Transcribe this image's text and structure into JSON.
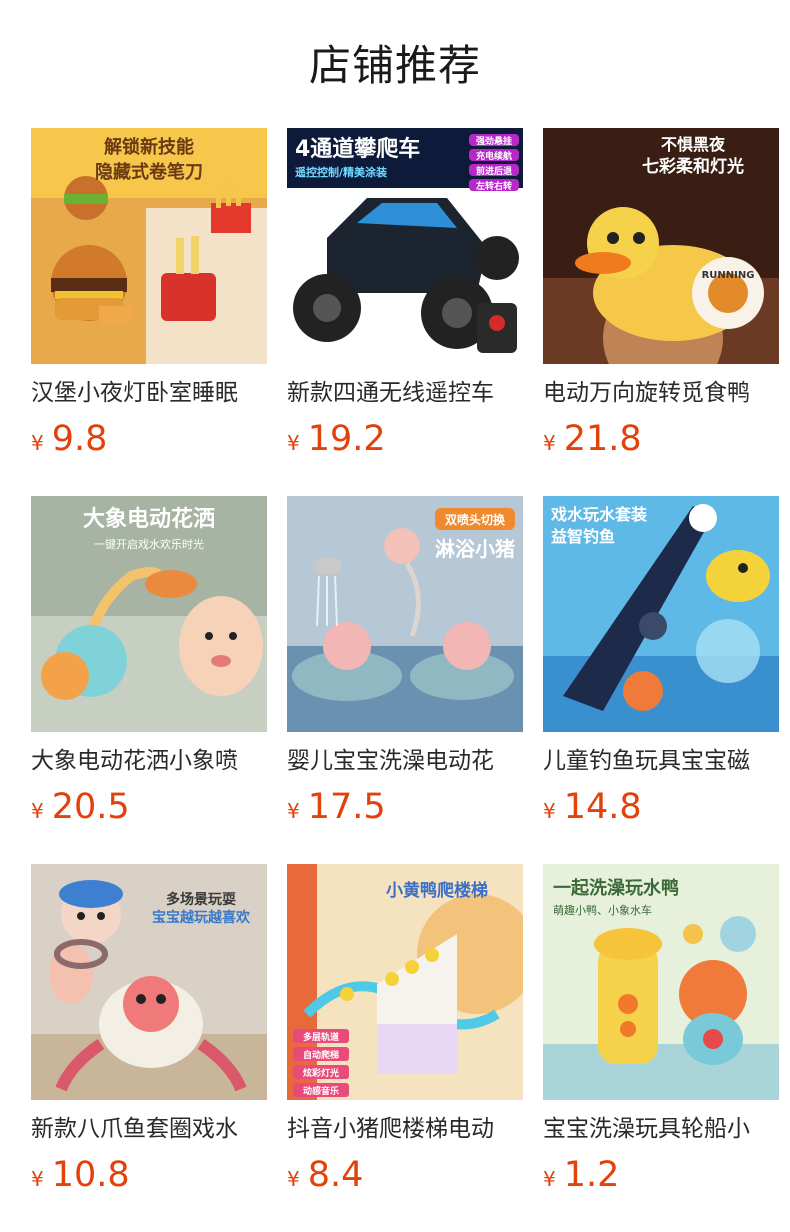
{
  "page": {
    "title": "店铺推荐"
  },
  "currency_symbol": "¥",
  "colors": {
    "price": "#e2410b",
    "title_text": "#2a2a2a"
  },
  "products": [
    {
      "name": "汉堡小夜灯卧室睡眠",
      "price": "9.8",
      "image_icon": "burger-toy-icon",
      "image_text": [
        "解锁新技能",
        "隐藏式卷笔刀"
      ]
    },
    {
      "name": "新款四通无线遥控车",
      "price": "19.2",
      "image_icon": "rc-car-icon",
      "image_text": [
        "4通道攀爬车",
        "遥控控制/精美涂装",
        "强劲悬挂",
        "充电续航",
        "前进后退",
        "左转右转"
      ]
    },
    {
      "name": "电动万向旋转觅食鸭",
      "price": "21.8",
      "image_icon": "duck-toy-icon",
      "image_text": [
        "不惧黑夜",
        "七彩柔和灯光",
        "RUNNING"
      ]
    },
    {
      "name": "大象电动花洒小象喷",
      "price": "20.5",
      "image_icon": "elephant-shower-icon",
      "image_text": [
        "大象电动花洒",
        "一键开启戏水欢乐时光"
      ]
    },
    {
      "name": "婴儿宝宝洗澡电动花",
      "price": "17.5",
      "image_icon": "pig-bath-icon",
      "image_text": [
        "双喷头切换",
        "淋浴小猪"
      ]
    },
    {
      "name": "儿童钓鱼玩具宝宝磁",
      "price": "14.8",
      "image_icon": "fishing-toy-icon",
      "image_text": [
        "戏水玩水套装",
        "益智钓鱼"
      ]
    },
    {
      "name": "新款八爪鱼套圈戏水",
      "price": "10.8",
      "image_icon": "octopus-toy-icon",
      "image_text": [
        "多场景玩耍",
        "宝宝越玩越喜欢"
      ]
    },
    {
      "name": "抖音小猪爬楼梯电动",
      "price": "8.4",
      "image_icon": "duck-stairs-icon",
      "image_text": [
        "小黄鸭爬楼梯",
        "多层轨道",
        "自动爬梯",
        "炫彩灯光",
        "动感音乐"
      ]
    },
    {
      "name": "宝宝洗澡玩具轮船小",
      "price": "1.2",
      "image_icon": "duck-boat-icon",
      "image_text": [
        "一起洗澡玩水鸭",
        "萌趣小鸭、小象水车"
      ]
    }
  ]
}
